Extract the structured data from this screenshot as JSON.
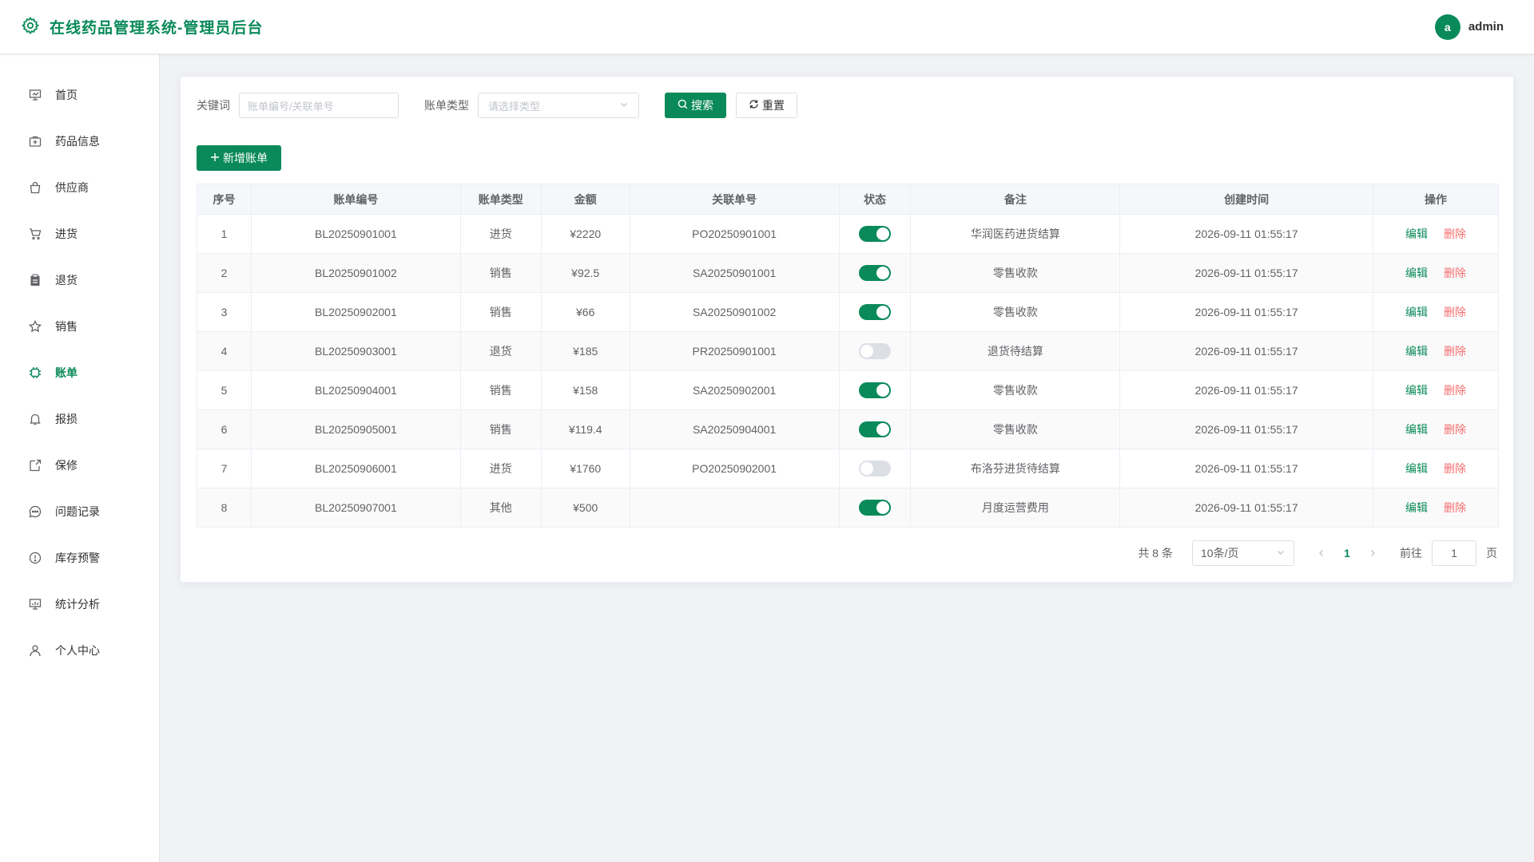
{
  "header": {
    "title": "在线药品管理系统-管理员后台",
    "avatar_letter": "a",
    "username": "admin",
    "brand_color": "#0a8a5a"
  },
  "sidebar": {
    "items": [
      {
        "label": "首页",
        "icon": "presentation-icon"
      },
      {
        "label": "药品信息",
        "icon": "medicine-box-icon"
      },
      {
        "label": "供应商",
        "icon": "shopping-bag-icon"
      },
      {
        "label": "进货",
        "icon": "cart-icon"
      },
      {
        "label": "退货",
        "icon": "clipboard-icon"
      },
      {
        "label": "销售",
        "icon": "star-icon"
      },
      {
        "label": "账单",
        "icon": "cpu-icon",
        "active": true
      },
      {
        "label": "报损",
        "icon": "bell-icon"
      },
      {
        "label": "保修",
        "icon": "share-icon"
      },
      {
        "label": "问题记录",
        "icon": "chat-icon"
      },
      {
        "label": "库存预警",
        "icon": "warning-icon"
      },
      {
        "label": "统计分析",
        "icon": "chart-board-icon"
      },
      {
        "label": "个人中心",
        "icon": "user-icon"
      }
    ]
  },
  "filters": {
    "keyword_label": "关键词",
    "keyword_placeholder": "账单编号/关联单号",
    "type_label": "账单类型",
    "type_placeholder": "请选择类型",
    "search_label": "搜索",
    "reset_label": "重置"
  },
  "add_button": "新增账单",
  "table": {
    "columns": [
      "序号",
      "账单编号",
      "账单类型",
      "金额",
      "关联单号",
      "状态",
      "备注",
      "创建时间",
      "操作"
    ],
    "rows": [
      {
        "no": "1",
        "code": "BL20250901001",
        "type": "进货",
        "amount": "¥2220",
        "ref": "PO20250901001",
        "status": true,
        "note": "华润医药进货结算",
        "time": "2026-09-11 01:55:17"
      },
      {
        "no": "2",
        "code": "BL20250901002",
        "type": "销售",
        "amount": "¥92.5",
        "ref": "SA20250901001",
        "status": true,
        "note": "零售收款",
        "time": "2026-09-11 01:55:17"
      },
      {
        "no": "3",
        "code": "BL20250902001",
        "type": "销售",
        "amount": "¥66",
        "ref": "SA20250901002",
        "status": true,
        "note": "零售收款",
        "time": "2026-09-11 01:55:17"
      },
      {
        "no": "4",
        "code": "BL20250903001",
        "type": "退货",
        "amount": "¥185",
        "ref": "PR20250901001",
        "status": false,
        "note": "退货待结算",
        "time": "2026-09-11 01:55:17"
      },
      {
        "no": "5",
        "code": "BL20250904001",
        "type": "销售",
        "amount": "¥158",
        "ref": "SA20250902001",
        "status": true,
        "note": "零售收款",
        "time": "2026-09-11 01:55:17"
      },
      {
        "no": "6",
        "code": "BL20250905001",
        "type": "销售",
        "amount": "¥119.4",
        "ref": "SA20250904001",
        "status": true,
        "note": "零售收款",
        "time": "2026-09-11 01:55:17"
      },
      {
        "no": "7",
        "code": "BL20250906001",
        "type": "进货",
        "amount": "¥1760",
        "ref": "PO20250902001",
        "status": false,
        "note": "布洛芬进货待结算",
        "time": "2026-09-11 01:55:17"
      },
      {
        "no": "8",
        "code": "BL20250907001",
        "type": "其他",
        "amount": "¥500",
        "ref": "",
        "status": true,
        "note": "月度运营费用",
        "time": "2026-09-11 01:55:17"
      }
    ],
    "edit_label": "编辑",
    "delete_label": "删除"
  },
  "pagination": {
    "total_text": "共 8 条",
    "page_size": "10条/页",
    "current_page": "1",
    "goto_label": "前往",
    "goto_value": "1",
    "page_suffix": "页"
  }
}
